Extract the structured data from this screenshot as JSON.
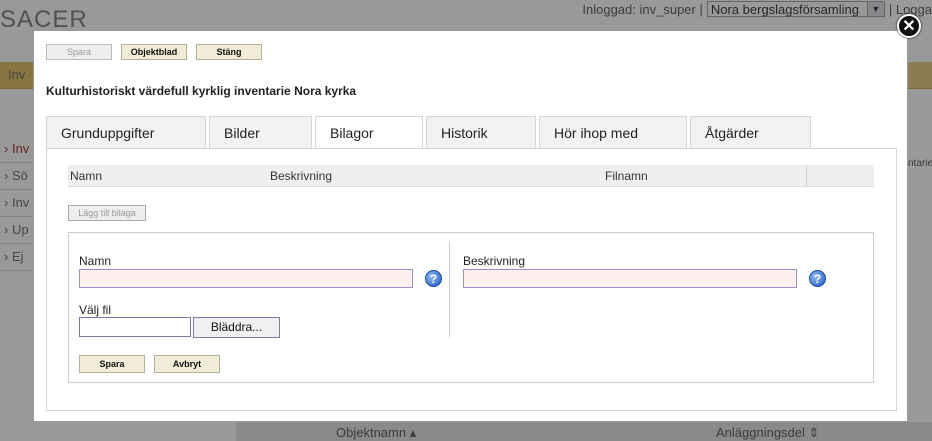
{
  "background": {
    "logo": "SACER",
    "logged_in_label": "Inloggad: inv_super |",
    "org_select": "Nora bergslagsförsamling",
    "logout": "| Logga",
    "nav_tab": "Inv",
    "side_items": [
      "Inv",
      "Sö",
      "Inv",
      "Up",
      "Ej"
    ],
    "right_fragment": "ntarie",
    "table_cols": [
      "Objektnamn ▴",
      "Anläggningsdel ⇕"
    ]
  },
  "dialog": {
    "toolbar": {
      "save": "Spara",
      "sheet": "Objektblad",
      "close": "Stäng"
    },
    "title": "Kulturhistoriskt värdefull kyrklig inventarie Nora kyrka",
    "tabs": [
      "Grunduppgifter",
      "Bilder",
      "Bilagor",
      "Historik",
      "Hör ihop med",
      "Åtgärder"
    ],
    "active_tab": "Bilagor",
    "grid_headers": [
      "Namn",
      "Beskrivning",
      "Filnamn"
    ],
    "add_attachment": "Lägg till bilaga",
    "form": {
      "name_label": "Namn",
      "name_value": "",
      "desc_label": "Beskrivning",
      "desc_value": "",
      "file_label": "Välj fil",
      "browse": "Bläddra...",
      "save": "Spara",
      "cancel": "Avbryt"
    }
  },
  "colors": {
    "accent": "#e8d08a",
    "field_bg": "#fdeef0",
    "field_border": "#9d8fc4"
  },
  "icons": {
    "close": "close-icon",
    "help": "help-icon",
    "select_arrow": "chevron-down-icon"
  }
}
